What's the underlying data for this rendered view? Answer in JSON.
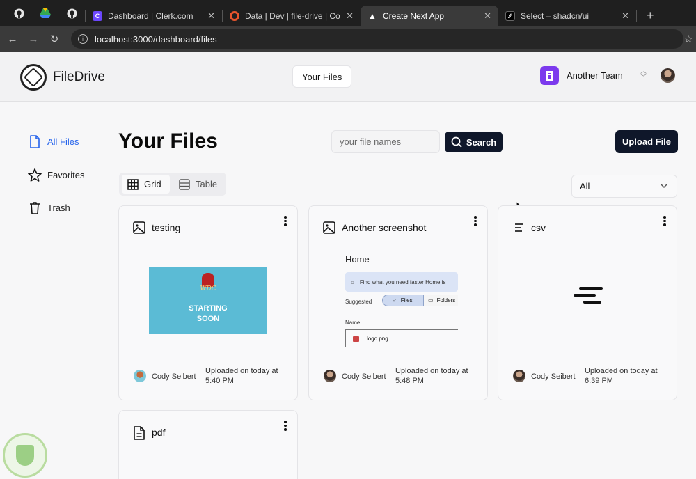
{
  "browser": {
    "tabs": [
      {
        "title": "Dashboard | Clerk.com",
        "active": false,
        "favicon_color": "#6c47ff"
      },
      {
        "title": "Data | Dev | file-drive | Conve",
        "active": false,
        "favicon_color": "#e8552d"
      },
      {
        "title": "Create Next App",
        "active": true,
        "favicon_color": "#ffffff"
      },
      {
        "title": "Select – shadcn/ui",
        "active": false,
        "favicon_color": "#000000"
      }
    ],
    "url": "localhost:3000/dashboard/files"
  },
  "header": {
    "brand": "FileDrive",
    "nav_tab": "Your Files",
    "team_name": "Another Team"
  },
  "sidebar": {
    "items": [
      {
        "label": "All Files",
        "icon": "file-icon",
        "active": true
      },
      {
        "label": "Favorites",
        "icon": "star-icon",
        "active": false
      },
      {
        "label": "Trash",
        "icon": "trash-icon",
        "active": false
      }
    ]
  },
  "main": {
    "title": "Your Files",
    "search_placeholder": "your file names",
    "search_label": "Search",
    "upload_label": "Upload File",
    "view_toggle": {
      "grid": "Grid",
      "table": "Table",
      "selected": "grid"
    },
    "type_filter": "All",
    "cards": [
      {
        "title": "testing",
        "type": "image",
        "user": "Cody Seibert",
        "uploaded": "Uploaded on today at 5:40 PM",
        "preview": {
          "badge": "WDC",
          "text_line1": "STARTING",
          "text_line2": "SOON"
        }
      },
      {
        "title": "Another screenshot",
        "type": "image",
        "user": "Cody Seibert",
        "uploaded": "Uploaded on today at 5:48 PM",
        "preview": {
          "heading": "Home",
          "search_text": "Find what you need faster  Home is",
          "suggested": "Suggested",
          "chip_files": "Files",
          "chip_folders": "Folders",
          "name_label": "Name",
          "file_name": "logo.png"
        }
      },
      {
        "title": "csv",
        "type": "csv",
        "user": "Cody Seibert",
        "uploaded": "Uploaded on today at 6:39 PM"
      },
      {
        "title": "pdf",
        "type": "pdf"
      }
    ]
  },
  "colors": {
    "accent": "#2563eb",
    "button_dark": "#0f172a",
    "team_avatar": "#7c3aed"
  }
}
